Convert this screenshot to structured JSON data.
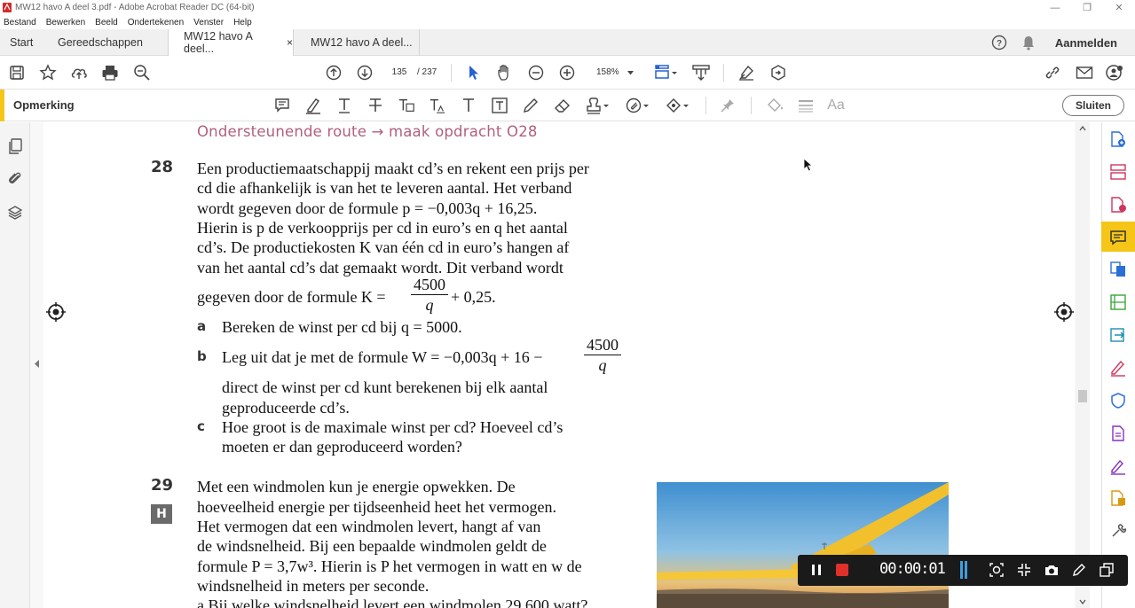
{
  "window": {
    "title": "MW12 havo A deel 3.pdf - Adobe Acrobat Reader DC (64-bit)",
    "controls": [
      "minimize-icon",
      "restore-icon",
      "close-icon"
    ]
  },
  "menu": [
    "Bestand",
    "Bewerken",
    "Beeld",
    "Ondertekenen",
    "Venster",
    "Help"
  ],
  "tabs": {
    "home": "Start",
    "tools": "Gereedschappen",
    "doc1": "MW12 havo A deel...",
    "doc1_close": "×",
    "doc2": "MW12 havo A deel...",
    "signin": "Aanmelden"
  },
  "toolbar": {
    "page_current": "135",
    "page_total": "/ 237",
    "zoom": "158%"
  },
  "commentbar": {
    "title": "Opmerking",
    "close_label": "Sluiten"
  },
  "document": {
    "route_heading": "Ondersteunende route → maak opdracht O28",
    "q28": {
      "number": "28",
      "intro": [
        "Een productiemaatschappij maakt cd’s en rekent een prijs per",
        "cd die afhankelijk is van het te leveren aantal. Het verband",
        "wordt gegeven door de formule p = −0,003q + 16,25.",
        "Hierin is p de verkoopprijs per cd in euro’s en q het aantal",
        "cd’s. De productiekosten K van één cd in euro’s hangen af",
        "van het aantal cd’s dat gemaakt wordt. Dit verband wordt",
        "gegeven door de formule K ="
      ],
      "formula_K_num": "4500",
      "formula_K_den": "q",
      "formula_K_tail": "+ 0,25.",
      "a_label": "a",
      "a_text": "Bereken de winst per cd bij q = 5000.",
      "b_label": "b",
      "b_text": "Leg uit dat je met de formule W = −0,003q + 16 −",
      "b_frac_num": "4500",
      "b_frac_den": "q",
      "b_cont": [
        "direct de winst per cd kunt berekenen bij elk aantal",
        "geproduceerde cd’s."
      ],
      "c_label": "c",
      "c_text": [
        "Hoe groot is de maximale winst per cd? Hoeveel cd’s",
        "moeten er dan geproduceerd worden?"
      ]
    },
    "q29": {
      "number": "29",
      "badge": "H",
      "lines": [
        "Met een windmolen kun je energie opwekken. De",
        "hoeveelheid energie per tijdseenheid heet het vermogen.",
        "Het vermogen dat een windmolen levert, hangt af van",
        "de windsnelheid. Bij een bepaalde windmolen geldt de",
        "formule P = 3,7w³. Hierin is P het vermogen in watt en w de",
        "windsnelheid in meters per seconde."
      ],
      "a_partial": "a   Bij welke windsnelheid levert een windmolen 29 600 watt?"
    }
  },
  "recorder": {
    "time": "00:00:01"
  },
  "colors": {
    "accent": "#f5c518",
    "route": "#b0617a",
    "rightpane_icons": [
      "#2b6fd6",
      "#d0365d",
      "#d0365d",
      "#333333",
      "#2b6fd6",
      "#3aa53a",
      "#1e8fb0",
      "#d0365d",
      "#2b6fd6",
      "#8a2fc0",
      "#8a2fc0",
      "#d69a12",
      "#555555"
    ]
  }
}
